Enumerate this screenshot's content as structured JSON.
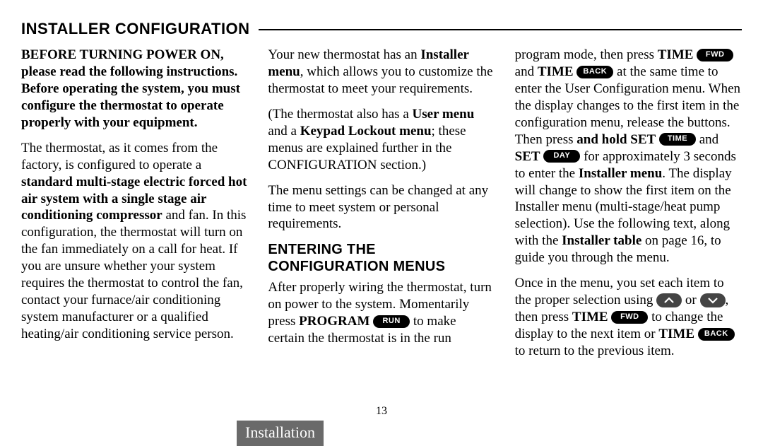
{
  "sectionTitle": "INSTALLER CONFIGURATION",
  "col1": {
    "p1_bold": "BEFORE TURNING POWER ON, please read the following instructions. Before operating the system, you must configure the thermostat to operate properly with your equipment.",
    "p2_pre": "The thermostat, as it comes from the factory, is configured to operate a ",
    "p2_bold": "standard multi-stage electric forced hot air system with a single stage air conditioning compressor",
    "p2_post": " and fan. In this configuration, the thermostat will turn on the fan immediately on a call for heat. If you are unsure whether your system requires the thermostat to control the fan, contact your furnace/air conditioning system manufacturer or a qualified heating/air conditioning service person."
  },
  "col2": {
    "p1_a": "Your new thermostat has an ",
    "p1_b": "Installer menu",
    "p1_c": ", which allows you to custom­ize the thermostat to meet your requirements.",
    "p2_a": "(The thermostat also has a ",
    "p2_b": "User menu",
    "p2_c": " and a ",
    "p2_d": "Keypad Lockout menu",
    "p2_e": "; these menus are explained further in the CONFIGURATION section.)",
    "p3": "The menu settings can be changed at any time to meet system or personal requirements.",
    "h2": "ENTERING THE CONFIGURATION MENUS",
    "p4_a": "After properly wiring the thermo­stat, turn on power to the system. Momentarily press ",
    "p4_b": "PROGRAM",
    "p4_c": " to make certain the thermo­stat is in the run program mode,"
  },
  "col3": {
    "p1_a": "then press ",
    "p1_b": "TIME",
    "p1_c": " and ",
    "p1_d": "TIME",
    "p1_e": " at the same time to enter the User Configuration menu. When the display changes to the first item in the configuration menu, release the buttons. Then press ",
    "p1_f": "and hold SET",
    "p1_g": " and ",
    "p1_h": "SET",
    "p1_i": " for approxi­mately 3 seconds to enter the ",
    "p1_j": "Installer menu",
    "p1_k": ". The display will change to show the first item on the Installer menu (multi-stage/heat pump selection).  Use the following text, along with the ",
    "p1_l": "Installer table",
    "p1_m": " on page 16, to guide you through the menu.",
    "p2_a": "Once in the menu, you set each item to the proper selection using ",
    "p2_b": " or ",
    "p2_c": ", then press ",
    "p2_d": "TIME",
    "p2_e": " to change the display to the next item or ",
    "p2_f": "TIME",
    "p2_g": " to return to the previous item."
  },
  "pills": {
    "run": "RUN",
    "fwd": "FWD",
    "back": "BACK",
    "time": "TIME",
    "day": "DAY"
  },
  "pageNumber": "13",
  "tab": "Installation"
}
